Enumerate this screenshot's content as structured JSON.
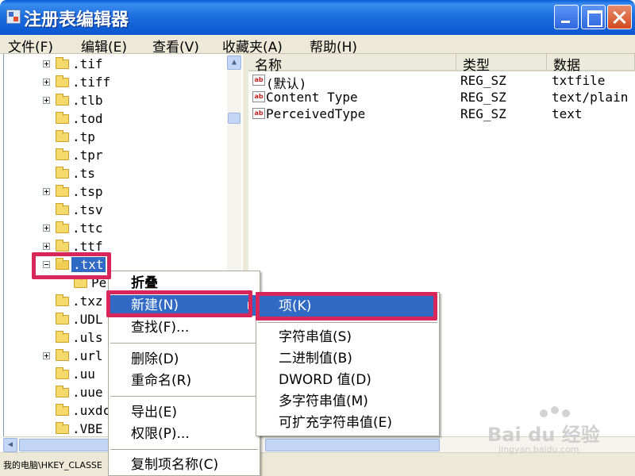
{
  "window": {
    "title": "注册表编辑器"
  },
  "menubar": {
    "items": [
      {
        "label": "文件(F)"
      },
      {
        "label": "编辑(E)"
      },
      {
        "label": "查看(V)"
      },
      {
        "label": "收藏夹(A)"
      },
      {
        "label": "帮助(H)"
      }
    ]
  },
  "tree": {
    "items": [
      {
        "label": ".tif",
        "expander": "plus"
      },
      {
        "label": ".tiff",
        "expander": "plus"
      },
      {
        "label": ".tlb",
        "expander": "plus"
      },
      {
        "label": ".tod",
        "expander": "none"
      },
      {
        "label": ".tp",
        "expander": "none"
      },
      {
        "label": ".tpr",
        "expander": "none"
      },
      {
        "label": ".ts",
        "expander": "none"
      },
      {
        "label": ".tsp",
        "expander": "plus"
      },
      {
        "label": ".tsv",
        "expander": "none"
      },
      {
        "label": ".ttc",
        "expander": "plus"
      },
      {
        "label": ".ttf",
        "expander": "plus"
      },
      {
        "label": ".txt",
        "expander": "minus",
        "selected": true
      },
      {
        "label": "Per",
        "expander": "none",
        "child": true
      },
      {
        "label": ".txz",
        "expander": "none"
      },
      {
        "label": ".UDL",
        "expander": "none"
      },
      {
        "label": ".uls",
        "expander": "none"
      },
      {
        "label": ".url",
        "expander": "plus"
      },
      {
        "label": ".uu",
        "expander": "none"
      },
      {
        "label": ".uue",
        "expander": "none"
      },
      {
        "label": ".uxdc",
        "expander": "none"
      },
      {
        "label": ".VBE",
        "expander": "none"
      }
    ]
  },
  "list": {
    "columns": [
      "名称",
      "类型",
      "数据"
    ],
    "rows": [
      {
        "name": "(默认)",
        "type": "REG_SZ",
        "data": "txtfile"
      },
      {
        "name": "Content Type",
        "type": "REG_SZ",
        "data": "text/plain"
      },
      {
        "name": "PerceivedType",
        "type": "REG_SZ",
        "data": "text"
      }
    ],
    "value_icon_text": "ab"
  },
  "context_menu": {
    "collapse": "折叠",
    "new": "新建(N)",
    "find": "查找(F)...",
    "delete": "删除(D)",
    "rename": "重命名(R)",
    "export": "导出(E)",
    "permissions": "权限(P)...",
    "copy_key_name": "复制项名称(C)"
  },
  "submenu": {
    "key": "项(K)",
    "string_value": "字符串值(S)",
    "binary_value": "二进制值(B)",
    "dword_value": "DWORD 值(D)",
    "multi_string_value": "多字符串值(M)",
    "expandable_string_value": "可扩充字符串值(E)"
  },
  "statusbar": {
    "path": "我的电脑\\HKEY_CLASSE"
  },
  "watermark": {
    "brand": "Bai du 经验",
    "url": "jingyan.baidu.com"
  },
  "colors": {
    "selection": "#316ac5",
    "annotation_box": "#d8255a",
    "titlebar": "#0a56d0"
  }
}
